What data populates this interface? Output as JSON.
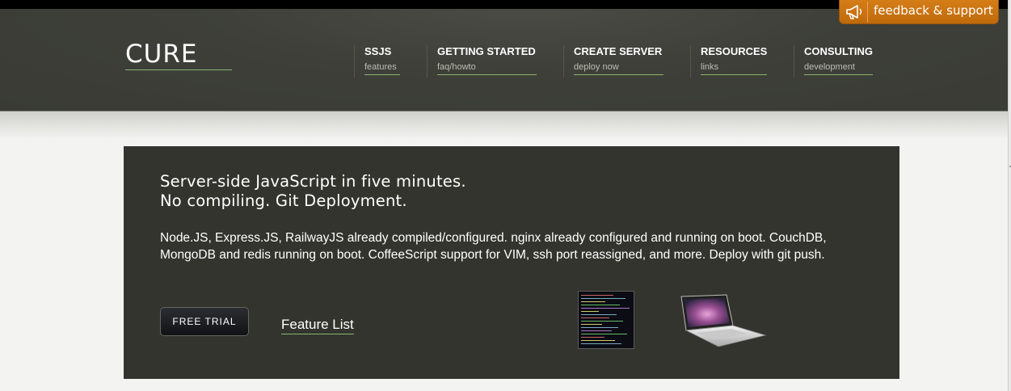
{
  "logo": {
    "text": "CURE"
  },
  "nav": [
    {
      "title": "SSJS",
      "sub": "features"
    },
    {
      "title": "GETTING STARTED",
      "sub": "faq/howto"
    },
    {
      "title": "CREATE SERVER",
      "sub": "deploy now"
    },
    {
      "title": "RESOURCES",
      "sub": "links"
    },
    {
      "title": "CONSULTING",
      "sub": "development"
    }
  ],
  "feedback": {
    "label": "feedback & support",
    "icon": "megaphone-icon",
    "color": "#cf7613"
  },
  "hero": {
    "headline_line1": "Server-side JavaScript in five minutes.",
    "headline_line2": "No compiling. Git Deployment.",
    "description": "Node.JS, Express.JS, RailwayJS already compiled/configured. nginx already configured and running on boot. CouchDB, MongoDB and redis running on boot. CoffeeScript support for VIM, ssh port reassigned, and more. Deploy with git push.",
    "trial_button": "FREE TRIAL",
    "feature_link": "Feature List"
  },
  "colors": {
    "header_bg": "#3e3f39",
    "hero_bg": "#34342e",
    "accent_underline": "#8ab56e"
  }
}
